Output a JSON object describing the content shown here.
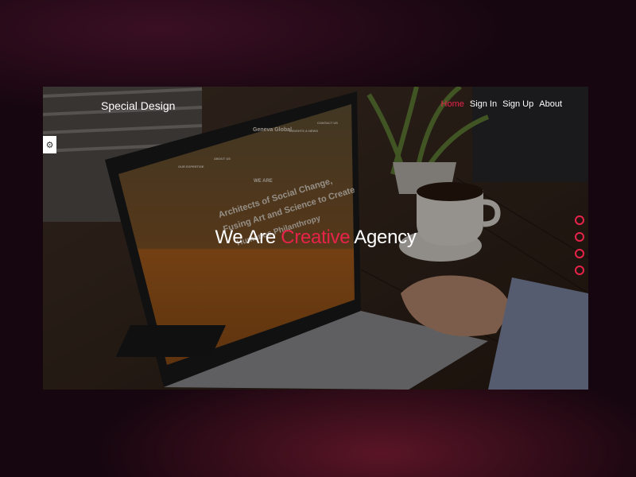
{
  "header": {
    "brand": "Special Design",
    "menu": [
      {
        "label": "Home",
        "active": true
      },
      {
        "label": "Sign In",
        "active": false
      },
      {
        "label": "Sign Up",
        "active": false
      },
      {
        "label": "About",
        "active": false
      }
    ]
  },
  "hero": {
    "prefix": "We Are ",
    "highlight": "Creative",
    "suffix": " Agency"
  },
  "settings": {
    "icon": "gear-icon"
  },
  "slider": {
    "count": 4,
    "icon": "bullet-circle-icon"
  },
  "screen_text": {
    "brand": "Geneva Global",
    "headline_1": "Architects of Social Change,",
    "headline_2": "Fusing Art and Science to Create",
    "headline_3": "Humanos Philanthropy",
    "nav_1": "OUR EXPERTISE",
    "nav_2": "ABOUT US",
    "nav_3": "INSIGHTS & NEWS",
    "nav_4": "CONTACT US",
    "tag": "WE ARE"
  },
  "colors": {
    "accent": "#e8234a",
    "text": "#ffffff",
    "background": "#16060f"
  }
}
